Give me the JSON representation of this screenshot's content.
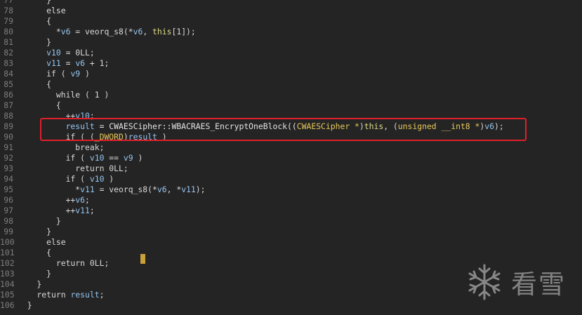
{
  "lines": [
    {
      "no": "77",
      "tokens": [
        {
          "t": "      }",
          "c": ""
        }
      ]
    },
    {
      "no": "78",
      "tokens": [
        {
          "t": "      else",
          "c": "c-kw"
        }
      ]
    },
    {
      "no": "79",
      "tokens": [
        {
          "t": "      {",
          "c": ""
        }
      ]
    },
    {
      "no": "80",
      "tokens": [
        {
          "t": "        *",
          "c": ""
        },
        {
          "t": "v6",
          "c": "c-var"
        },
        {
          "t": " = veorq_s8(*",
          "c": ""
        },
        {
          "t": "v6",
          "c": "c-var"
        },
        {
          "t": ", ",
          "c": ""
        },
        {
          "t": "this",
          "c": "c-this"
        },
        {
          "t": "[1]);",
          "c": ""
        }
      ]
    },
    {
      "no": "81",
      "tokens": [
        {
          "t": "      }",
          "c": ""
        }
      ]
    },
    {
      "no": "82",
      "tokens": [
        {
          "t": "      ",
          "c": ""
        },
        {
          "t": "v10",
          "c": "c-var"
        },
        {
          "t": " = 0LL;",
          "c": ""
        }
      ]
    },
    {
      "no": "83",
      "tokens": [
        {
          "t": "      ",
          "c": ""
        },
        {
          "t": "v11",
          "c": "c-var"
        },
        {
          "t": " = ",
          "c": ""
        },
        {
          "t": "v6",
          "c": "c-var"
        },
        {
          "t": " + 1;",
          "c": ""
        }
      ]
    },
    {
      "no": "84",
      "tokens": [
        {
          "t": "      if ( ",
          "c": ""
        },
        {
          "t": "v9",
          "c": "c-var"
        },
        {
          "t": " )",
          "c": ""
        }
      ]
    },
    {
      "no": "85",
      "tokens": [
        {
          "t": "      {",
          "c": ""
        }
      ]
    },
    {
      "no": "86",
      "tokens": [
        {
          "t": "        while ( 1 )",
          "c": ""
        }
      ]
    },
    {
      "no": "87",
      "tokens": [
        {
          "t": "        {",
          "c": ""
        }
      ]
    },
    {
      "no": "88",
      "tokens": [
        {
          "t": "          ++",
          "c": ""
        },
        {
          "t": "v10",
          "c": "c-var"
        },
        {
          "t": ";",
          "c": ""
        }
      ]
    },
    {
      "no": "89",
      "tokens": [
        {
          "t": "          ",
          "c": ""
        },
        {
          "t": "result",
          "c": "c-var"
        },
        {
          "t": " = CWAESCipher::WBACRAES_EncryptOneBlock((",
          "c": "c-fn"
        },
        {
          "t": "CWAESCipher *",
          "c": "c-type"
        },
        {
          "t": ")",
          "c": ""
        },
        {
          "t": "this",
          "c": "c-this"
        },
        {
          "t": ", (",
          "c": ""
        },
        {
          "t": "unsigned __int8 *",
          "c": "c-type"
        },
        {
          "t": ")",
          "c": ""
        },
        {
          "t": "v6",
          "c": "c-var"
        },
        {
          "t": ");",
          "c": ""
        }
      ]
    },
    {
      "no": "90",
      "tokens": [
        {
          "t": "          if ( (",
          "c": ""
        },
        {
          "t": "_DWORD",
          "c": "c-type"
        },
        {
          "t": ")",
          "c": ""
        },
        {
          "t": "result",
          "c": "c-var"
        },
        {
          "t": " )",
          "c": ""
        }
      ]
    },
    {
      "no": "91",
      "tokens": [
        {
          "t": "            break;",
          "c": ""
        }
      ]
    },
    {
      "no": "92",
      "tokens": [
        {
          "t": "          if ( ",
          "c": ""
        },
        {
          "t": "v10",
          "c": "c-var"
        },
        {
          "t": " == ",
          "c": ""
        },
        {
          "t": "v9",
          "c": "c-var"
        },
        {
          "t": " )",
          "c": ""
        }
      ]
    },
    {
      "no": "93",
      "tokens": [
        {
          "t": "            return 0LL;",
          "c": ""
        }
      ]
    },
    {
      "no": "94",
      "tokens": [
        {
          "t": "          if ( ",
          "c": ""
        },
        {
          "t": "v10",
          "c": "c-var"
        },
        {
          "t": " )",
          "c": ""
        }
      ]
    },
    {
      "no": "95",
      "tokens": [
        {
          "t": "            *",
          "c": ""
        },
        {
          "t": "v11",
          "c": "c-var"
        },
        {
          "t": " = veorq_s8(*",
          "c": ""
        },
        {
          "t": "v6",
          "c": "c-var"
        },
        {
          "t": ", *",
          "c": ""
        },
        {
          "t": "v11",
          "c": "c-var"
        },
        {
          "t": ");",
          "c": ""
        }
      ]
    },
    {
      "no": "96",
      "tokens": [
        {
          "t": "          ++",
          "c": ""
        },
        {
          "t": "v6",
          "c": "c-var"
        },
        {
          "t": ";",
          "c": ""
        }
      ]
    },
    {
      "no": "97",
      "tokens": [
        {
          "t": "          ++",
          "c": ""
        },
        {
          "t": "v11",
          "c": "c-var"
        },
        {
          "t": ";",
          "c": ""
        }
      ]
    },
    {
      "no": "98",
      "tokens": [
        {
          "t": "        }",
          "c": ""
        }
      ]
    },
    {
      "no": "99",
      "tokens": [
        {
          "t": "      }",
          "c": ""
        }
      ]
    },
    {
      "no": "100",
      "tokens": [
        {
          "t": "      else",
          "c": ""
        }
      ]
    },
    {
      "no": "101",
      "tokens": [
        {
          "t": "      {",
          "c": ""
        }
      ]
    },
    {
      "no": "102",
      "tokens": [
        {
          "t": "        return 0LL;",
          "c": ""
        }
      ]
    },
    {
      "no": "103",
      "tokens": [
        {
          "t": "      }",
          "c": ""
        }
      ]
    },
    {
      "no": "104",
      "tokens": [
        {
          "t": "    }",
          "c": ""
        }
      ]
    },
    {
      "no": "105",
      "tokens": [
        {
          "t": "    return ",
          "c": ""
        },
        {
          "t": "result",
          "c": "c-var"
        },
        {
          "t": ";",
          "c": ""
        }
      ]
    },
    {
      "no": "106",
      "tokens": [
        {
          "t": "  }",
          "c": ""
        }
      ]
    }
  ],
  "watermark": {
    "text": "看雪",
    "icon": "snowflake-icon"
  },
  "colors": {
    "background": "#242424",
    "highlight_box": "#e0202a",
    "variable": "#95c5f0",
    "type": "#e8c75a"
  }
}
